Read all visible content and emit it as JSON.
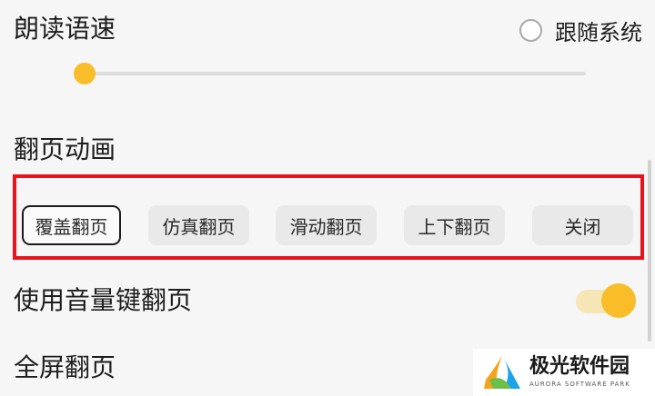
{
  "speech_speed": {
    "title": "朗读语速",
    "follow_system_label": "跟随系统",
    "follow_system_checked": false,
    "slider_value_fraction": 0.02,
    "accent_color": "#f8bd29"
  },
  "page_animation": {
    "title": "翻页动画",
    "options": [
      "覆盖翻页",
      "仿真翻页",
      "滑动翻页",
      "上下翻页",
      "关闭"
    ],
    "selected": "覆盖翻页",
    "highlight_color": "#e8131e"
  },
  "volume_key_flip": {
    "title": "使用音量键翻页",
    "enabled": true
  },
  "fullscreen_flip": {
    "title": "全屏翻页"
  },
  "watermark": {
    "name_cn": "极光软件园",
    "name_en": "AURORA SOFTWARE PARK",
    "logo_icon": "aurora-logo-icon"
  }
}
